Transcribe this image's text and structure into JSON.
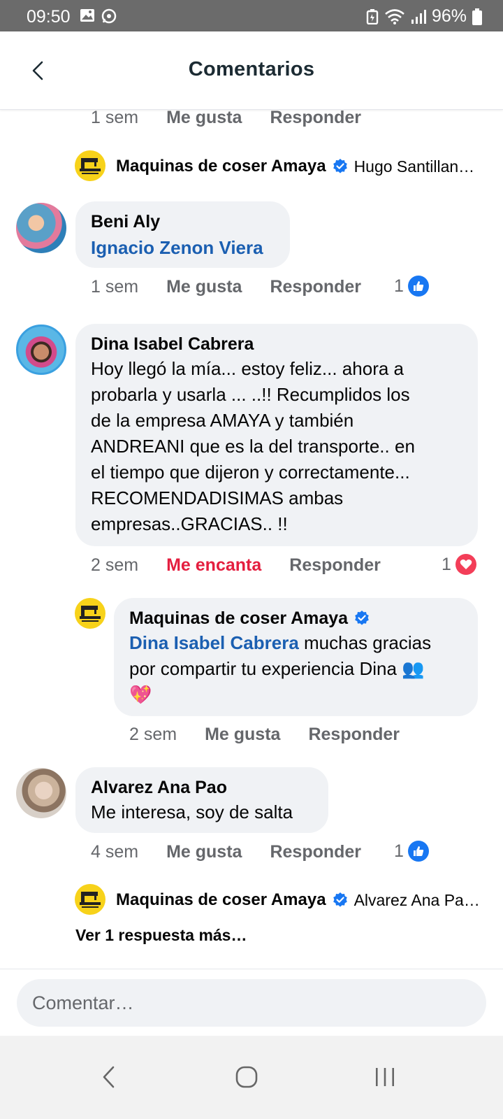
{
  "status_bar": {
    "time": "09:50",
    "battery": "96%",
    "icons": [
      "gallery-icon",
      "whatsapp-icon",
      "battery-saver-icon",
      "wifi-icon",
      "signal-icon",
      "battery-icon"
    ]
  },
  "header": {
    "title": "Comentarios",
    "back_icon": "back-arrow-icon"
  },
  "top_meta": {
    "time": "1 sem",
    "like": "Me gusta",
    "reply": "Responder"
  },
  "reply_preview_1": {
    "author": "Maquinas de coser Amaya",
    "text": "Hugo Santillan…"
  },
  "comments": [
    {
      "author": "Beni Aly",
      "mention": "Ignacio Zenon Viera",
      "time": "1 sem",
      "like": "Me gusta",
      "reply": "Responder",
      "reaction_count": "1",
      "reaction": "like"
    },
    {
      "author": "Dina Isabel Cabrera",
      "text_lines": [
        "Hoy llegó la mía... estoy feliz... ahora a",
        "probarla y usarla ... ..!! Recumplidos  los",
        "de la empresa AMAYA  y también",
        "ANDREANI que es la del transporte.. en",
        "el tiempo que dijeron y correctamente...",
        "RECOMENDADISIMAS ambas",
        "empresas..GRACIAS.. !!"
      ],
      "time": "2 sem",
      "like": "Me encanta",
      "reply": "Responder",
      "reaction_count": "1",
      "reaction": "love",
      "reply_comment": {
        "author": "Maquinas de coser Amaya",
        "mention": "Dina Isabel Cabrera",
        "text_a": " muchas gracias",
        "text_b": "por compartir tu experiencia Dina",
        "emoji_people": "👥",
        "emoji_heart": "💖",
        "time": "2 sem",
        "like": "Me gusta",
        "reply": "Responder"
      }
    },
    {
      "author": "Alvarez Ana Pao",
      "text": "Me interesa, soy de salta",
      "time": "4 sem",
      "like": "Me gusta",
      "reply": "Responder",
      "reaction_count": "1",
      "reaction": "like"
    }
  ],
  "reply_preview_2": {
    "author": "Maquinas de coser Amaya",
    "text": "Alvarez Ana Pa…"
  },
  "more_replies": "Ver 1 respuesta más…",
  "composer": {
    "placeholder": "Comentar…"
  },
  "colors": {
    "accent": "#1877f2",
    "love": "#e41e3f",
    "bubble": "#f0f2f5",
    "meta": "#65676b"
  },
  "nav": {
    "icons": [
      "back-nav-icon",
      "home-nav-icon",
      "recents-nav-icon"
    ]
  }
}
